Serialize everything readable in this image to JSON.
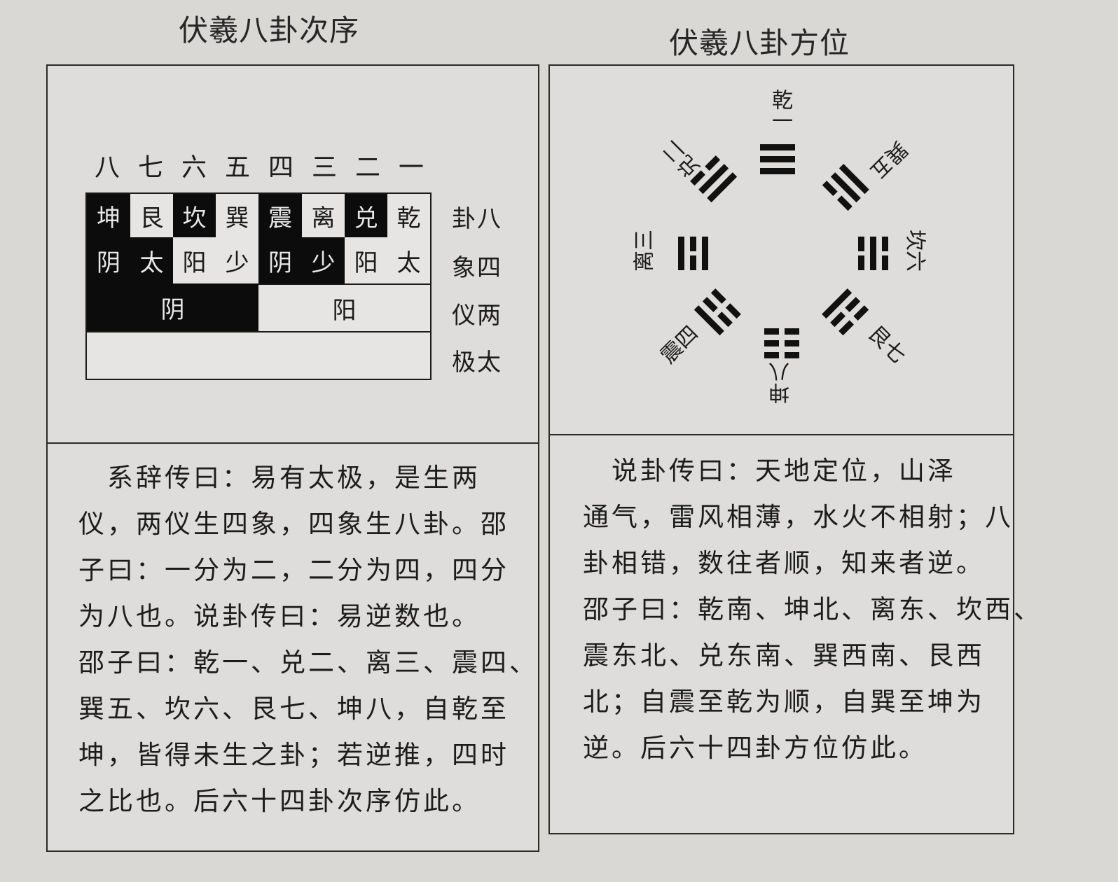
{
  "left": {
    "title": "伏羲八卦次序",
    "numbers": [
      "八",
      "七",
      "六",
      "五",
      "四",
      "三",
      "二",
      "一"
    ],
    "trigrams": [
      "坤",
      "艮",
      "坎",
      "巽",
      "震",
      "离",
      "兑",
      "乾"
    ],
    "four_images": [
      "阴",
      "太",
      "阳",
      "少",
      "阴",
      "少",
      "阳",
      "太"
    ],
    "two_modes": [
      "阴",
      "阳"
    ],
    "row_labels": [
      "卦八",
      "象四",
      "仪两",
      "极太"
    ],
    "text_lines": [
      "　系辞传曰：易有太极，是生两",
      "仪，两仪生四象，四象生八卦。邵",
      "子曰：一分为二，二分为四，四分",
      "为八也。说卦传曰：易逆数也。",
      "邵子曰：乾一、兑二、离三、震四、",
      "巽五、坎六、艮七、坤八，自乾至",
      "坤，皆得未生之卦；若逆推，四时",
      "之比也。后六十四卦次序仿此。"
    ]
  },
  "right": {
    "title": "伏羲八卦方位",
    "positions": {
      "qian": "乾一",
      "dui": "兑二",
      "xun": "巽五",
      "li": "离三",
      "kan": "坎六",
      "zhen": "震四",
      "gen": "艮七",
      "kun": "坤八"
    },
    "text_lines": [
      "　说卦传曰：天地定位，山泽",
      "通气，雷风相薄，水火不相射；八",
      "卦相错，数往者顺，知来者逆。",
      "邵子曰：乾南、坤北、离东、坎西、",
      "震东北、兑东南、巽西南、艮西",
      "北；自震至乾为顺，自巽至坤为",
      "逆。后六十四卦方位仿此。"
    ]
  }
}
